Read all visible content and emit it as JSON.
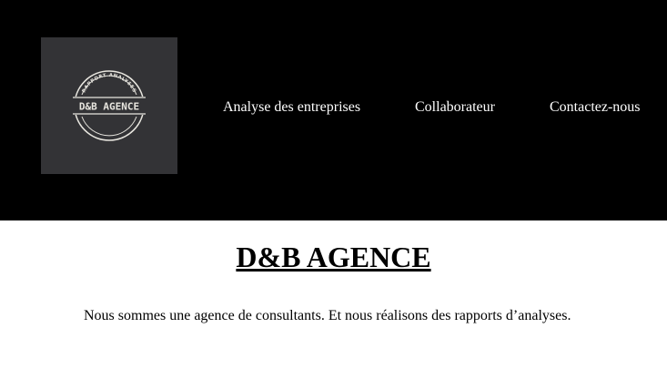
{
  "header": {
    "logo": {
      "top_arc_text": "RAPPORT ANALYSES",
      "name": "D&B AGENCE"
    },
    "nav": [
      {
        "label": "Analyse des entreprises"
      },
      {
        "label": "Collaborateur"
      },
      {
        "label": "Contactez-nous"
      }
    ]
  },
  "main": {
    "title": "D&B AGENCE",
    "intro": "Nous sommes une agence de consultants. Et nous réalisons des rapports d’analyses."
  },
  "colors": {
    "header_bg": "#000000",
    "logo_bg": "#333336",
    "logo_ink": "#e8e6df",
    "page_bg": "#ffffff"
  }
}
